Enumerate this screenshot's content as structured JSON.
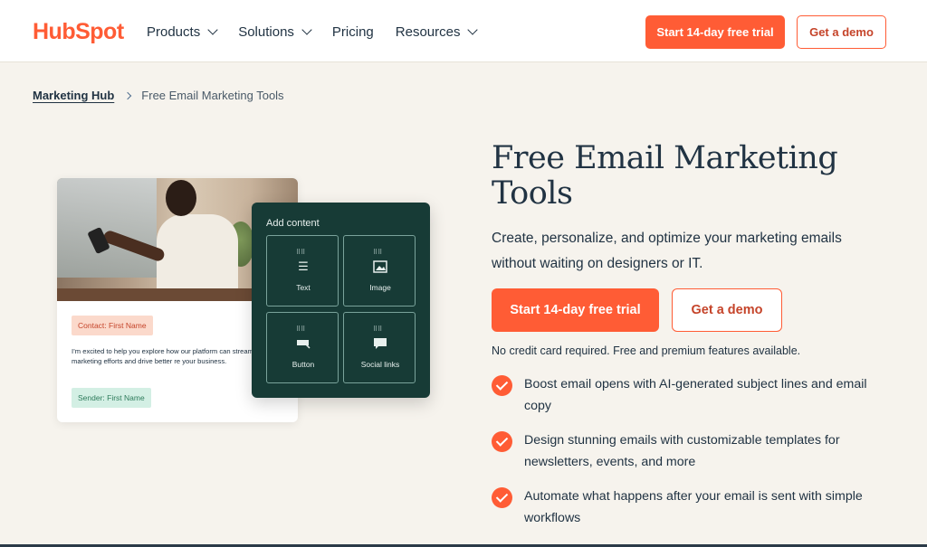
{
  "header": {
    "logo": "HubSpot",
    "nav": [
      {
        "label": "Products",
        "dropdown": true
      },
      {
        "label": "Solutions",
        "dropdown": true
      },
      {
        "label": "Pricing",
        "dropdown": false
      },
      {
        "label": "Resources",
        "dropdown": true
      }
    ],
    "trial_button": "Start 14-day free trial",
    "demo_button": "Get a demo"
  },
  "breadcrumb": {
    "parent": "Marketing Hub",
    "current": "Free Email Marketing Tools"
  },
  "illustration": {
    "contact_tag": "Contact: First Name",
    "email_body": "I’m excited to help you explore how our platform can streamline your marketing efforts and drive better re your business.",
    "sender_tag": "Sender: First Name",
    "panel_title": "Add content",
    "tiles": [
      {
        "label": "Text",
        "icon": "text-icon"
      },
      {
        "label": "Image",
        "icon": "image-icon"
      },
      {
        "label": "Button",
        "icon": "button-icon"
      },
      {
        "label": "Social links",
        "icon": "social-links-icon"
      }
    ]
  },
  "hero": {
    "title": "Free Email Marketing Tools",
    "subtitle": "Create, personalize, and optimize your marketing emails without waiting on designers or IT.",
    "trial_button": "Start 14-day free trial",
    "demo_button": "Get a demo",
    "disclaimer": "No credit card required. Free and premium features available.",
    "features": [
      "Boost email opens with AI-generated subject lines and email copy",
      "Design stunning emails with customizable templates for newsletters, events, and more",
      "Automate what happens after your email is sent with simple workflows"
    ]
  },
  "colors": {
    "accent": "#ff5c35",
    "background": "#f6f3ed",
    "panel": "#173b36",
    "text": "#213343"
  }
}
